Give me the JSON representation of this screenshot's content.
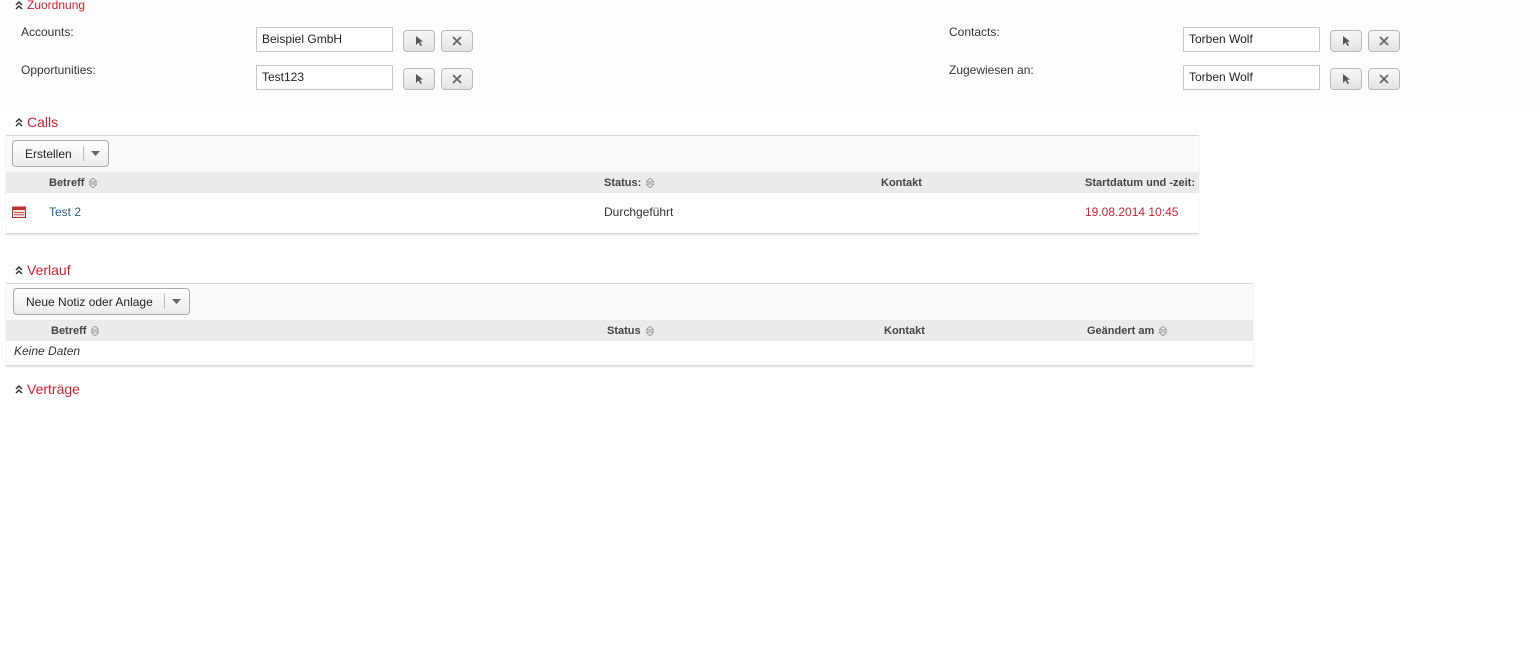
{
  "zuordnung": {
    "title": "Zuordnung",
    "accounts": {
      "label": "Accounts:",
      "value": "Beispiel GmbH"
    },
    "opportunities": {
      "label": "Opportunities:",
      "value": "Test123"
    },
    "contacts": {
      "label": "Contacts:",
      "value": "Torben Wolf"
    },
    "assigned": {
      "label": "Zugewiesen an:",
      "value": "Torben Wolf"
    }
  },
  "calls": {
    "title": "Calls",
    "create_label": "Erstellen",
    "columns": [
      "Betreff",
      "Status:",
      "Kontakt",
      "Startdatum und -zeit:"
    ],
    "rows": [
      {
        "subject": "Test 2",
        "status": "Durchgeführt",
        "contact": "",
        "start": "19.08.2014 10:45"
      }
    ]
  },
  "verlauf": {
    "title": "Verlauf",
    "create_label": "Neue Notiz oder Anlage",
    "columns": [
      "Betreff",
      "Status",
      "Kontakt",
      "Geändert am"
    ],
    "empty_text": "Keine Daten"
  },
  "vertraege": {
    "title": "Verträge"
  },
  "colors": {
    "accent": "#cc2233",
    "link": "#2b5d8a",
    "header_bg": "#ebebeb"
  }
}
